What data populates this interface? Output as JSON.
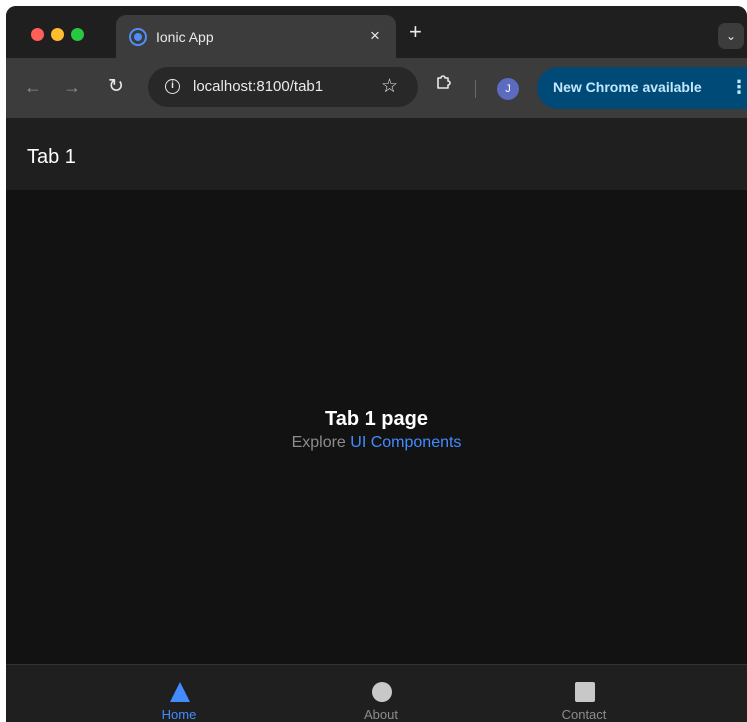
{
  "browser": {
    "tab": {
      "title": "Ionic App",
      "close_label": "×",
      "favicon": "ionic-logo-icon"
    },
    "new_tab_label": "+",
    "tab_dropdown_label": "⌄",
    "nav": {
      "back_icon": "arrow-left-icon",
      "forward_icon": "arrow-right-icon",
      "reload_icon": "reload-icon",
      "back_glyph": "←",
      "forward_glyph": "→",
      "reload_glyph": "↻"
    },
    "omnibox": {
      "info_glyph": "i",
      "url": "localhost:8100/tab1",
      "star_glyph": "☆"
    },
    "profile_initial": "J",
    "update_button": {
      "label": "New Chrome available",
      "menu_glyph": "⋮"
    },
    "colors": {
      "accent": "#4f8ef7",
      "update_bg": "#004a77",
      "update_text": "#c2e7ff"
    }
  },
  "app": {
    "header": {
      "title": "Tab 1"
    },
    "content": {
      "heading": "Tab 1 page",
      "explore_prefix": "Explore",
      "explore_link": "UI Components"
    },
    "tabbar": {
      "items": [
        {
          "label": "Home",
          "icon": "triangle-icon",
          "selected": true
        },
        {
          "label": "About",
          "icon": "ellipse-icon",
          "selected": false
        },
        {
          "label": "Contact",
          "icon": "square-icon",
          "selected": false
        }
      ]
    },
    "colors": {
      "primary": "#428cff",
      "background": "#121212",
      "toolbar": "#1f1f1f"
    }
  }
}
